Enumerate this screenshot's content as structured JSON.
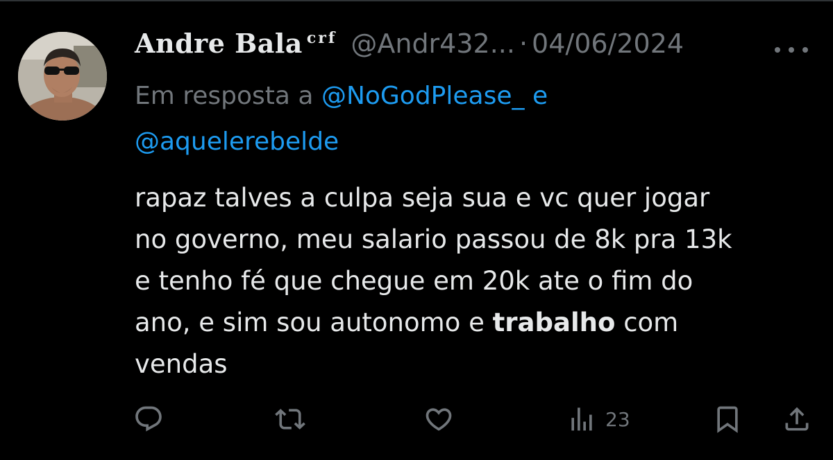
{
  "tweet": {
    "author": {
      "display_name": "Andre Bala",
      "name_suffix": "crf",
      "handle": "@Andr432...",
      "separator": "·",
      "date": "04/06/2024"
    },
    "reply_to": {
      "prefix": "Em resposta a",
      "mention_1": "@NoGodPlease_",
      "conjunction": "e",
      "mention_2": "@aquelerebelde"
    },
    "text": {
      "line_1": "rapaz talves a culpa seja sua e vc quer jogar",
      "line_2": "no governo, meu salario passou de 8k pra 13k",
      "line_3": "e tenho fé que chegue em 20k ate o fim do",
      "line_4_start": "ano, e sim sou autonomo e",
      "line_4_bold": "trabalho",
      "line_4_end": "com",
      "line_5": "vendas"
    },
    "actions": {
      "views_count": "23"
    }
  },
  "icons": {
    "reply": "reply-icon",
    "retweet": "retweet-icon",
    "like": "heart-icon",
    "views": "views-bar-chart-icon",
    "bookmark": "bookmark-icon",
    "share": "share-icon",
    "more": "more-dots-icon"
  },
  "colors": {
    "background": "#000000",
    "text_primary": "#e7e9ea",
    "text_secondary": "#71767b",
    "link": "#1d9bf0",
    "divider": "#2f3336"
  }
}
